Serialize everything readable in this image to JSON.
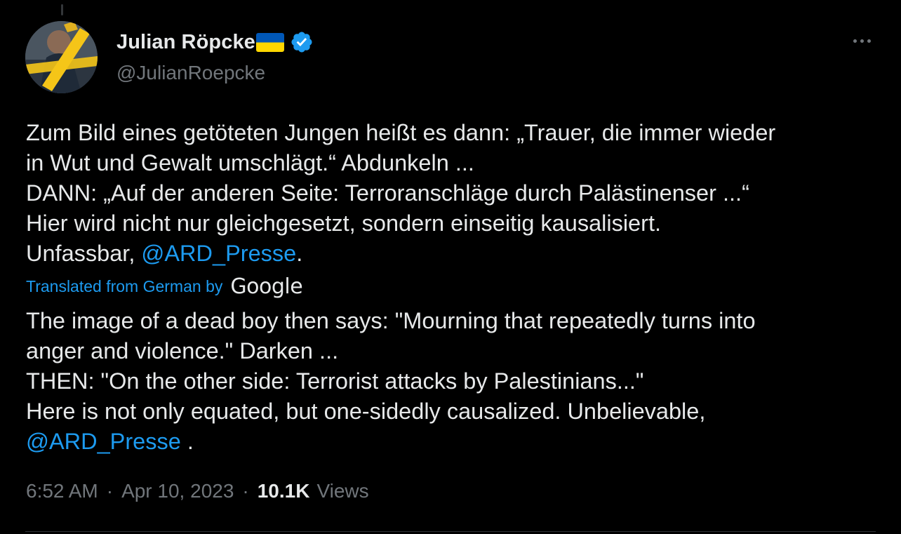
{
  "author": {
    "display_name": "Julian Röpcke",
    "handle": "@JulianRoepcke",
    "flag_icon": "ukraine-flag-icon",
    "verified_icon": "verified-badge-icon"
  },
  "more_icon": "more-options-icon",
  "tweet": {
    "lines": [
      "Zum Bild eines getöteten Jungen heißt es dann: „Trauer, die immer wieder",
      "in Wut und Gewalt umschlägt.“ Abdunkeln ...",
      "DANN: „Auf der anderen Seite: Terroranschläge durch Palästinenser ...“",
      "Hier wird nicht nur gleichgesetzt, sondern einseitig kausalisiert."
    ],
    "last_line_prefix": "Unfassbar, ",
    "mention": "@ARD_Presse",
    "last_line_suffix": "."
  },
  "translation": {
    "label": "Translated from German by",
    "provider": "Google",
    "lines": [
      "The image of a dead boy then says: \"Mourning that repeatedly turns into",
      "anger and violence.\" Darken ...",
      "THEN: \"On the other side: Terrorist attacks by Palestinians...\"",
      "Here is not only equated, but one-sidedly causalized. Unbelievable,"
    ],
    "mention": "@ARD_Presse",
    "mention_suffix": " ."
  },
  "meta": {
    "time": "6:52 AM",
    "separator": "·",
    "date": "Apr 10, 2023",
    "views_count": "10.1K",
    "views_label": "Views"
  },
  "colors": {
    "background": "#000000",
    "text": "#e7e9ea",
    "secondary": "#71767b",
    "link": "#1d9bf0",
    "verified": "#1d9bf0",
    "flag_blue": "#0057b7",
    "flag_yellow": "#ffd700"
  }
}
